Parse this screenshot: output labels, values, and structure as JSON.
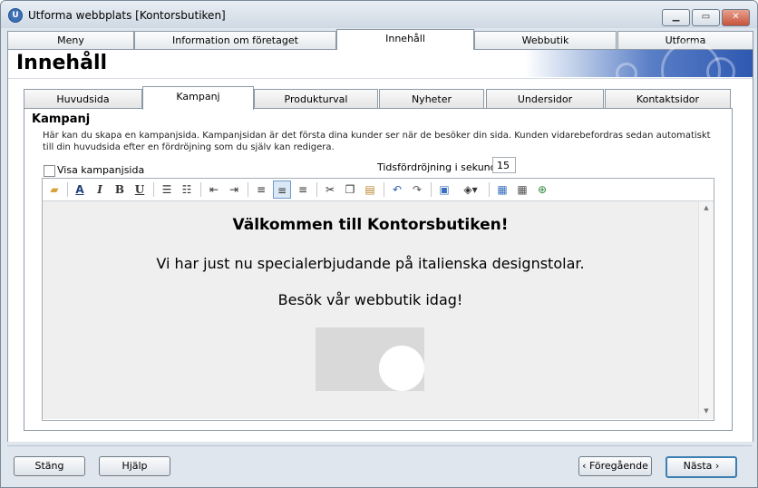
{
  "window": {
    "title": "Utforma webbplats [Kontorsbutiken]",
    "minimize_glyph": "▁",
    "maximize_glyph": "▭",
    "close_glyph": "✕",
    "app_icon_glyph": "U"
  },
  "main_tabs": [
    {
      "label": "Meny",
      "active": false
    },
    {
      "label": "Information om företaget",
      "active": false
    },
    {
      "label": "Innehåll",
      "active": true
    },
    {
      "label": "Webbutik",
      "active": false
    },
    {
      "label": "Utforma",
      "active": false
    }
  ],
  "page": {
    "title": "Innehåll"
  },
  "sub_tabs": [
    {
      "label": "Huvudsida",
      "active": false
    },
    {
      "label": "Kampanj",
      "active": true
    },
    {
      "label": "Produkturval",
      "active": false
    },
    {
      "label": "Nyheter",
      "active": false
    },
    {
      "label": "Undersidor",
      "active": false
    },
    {
      "label": "Kontaktsidor",
      "active": false
    }
  ],
  "campaign": {
    "section_title": "Kampanj",
    "description": "Här kan du skapa en kampanjsida. Kampanjsidan är det första dina kunder ser när de besöker din sida. Kunden vidarebefordras sedan automatiskt till din huvudsida efter en fördröjning som du själv kan redigera.",
    "show_checkbox_label": "Visa kampanjsida",
    "show_checked": false,
    "delay_label": "Tidsfördröjning i sekunder",
    "delay_value": "15"
  },
  "toolbar_icons": [
    "open-folder-icon",
    "font-icon",
    "italic-icon",
    "bold-icon",
    "underline-icon",
    "numbered-list-icon",
    "bullet-list-icon",
    "outdent-icon",
    "indent-icon",
    "align-left-icon",
    "align-center-icon",
    "align-right-icon",
    "cut-icon",
    "copy-icon",
    "paste-icon",
    "undo-icon",
    "redo-icon",
    "insert-image-icon",
    "fill-color-icon",
    "insert-table-icon",
    "table-properties-icon",
    "insert-link-icon"
  ],
  "editor": {
    "heading": "Välkommen till Kontorsbutiken!",
    "line2": "Vi har just nu specialerbjudande på italienska designstolar.",
    "line3": "Besök vår webbutik idag!"
  },
  "footer": {
    "close_label": "Stäng",
    "help_label": "Hjälp",
    "prev_label": "‹ Föregående",
    "next_label": "Nästa ›"
  }
}
